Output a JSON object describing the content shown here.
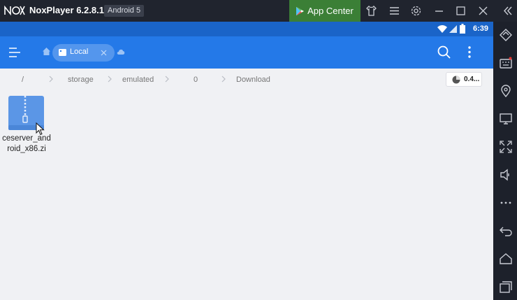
{
  "window": {
    "app_name": "NoxPlayer 6.2.8.1",
    "android_version": "Android 5",
    "app_center_label": "App Center"
  },
  "status_bar": {
    "time": "6:39"
  },
  "app_bar": {
    "active_tab": "Local"
  },
  "breadcrumb": {
    "segments": [
      "/",
      "storage",
      "emulated",
      "0",
      "Download"
    ]
  },
  "storage_indicator": {
    "value": "0.4..."
  },
  "files": [
    {
      "name": "ceserver_android_x86.zi",
      "icon": "zip-file-icon"
    }
  ],
  "colors": {
    "titlebar": "#20242e",
    "app_center": "#3b7f36",
    "status_bar": "#1a64c8",
    "app_bar": "#2479e8",
    "background": "#f0f1f4"
  }
}
